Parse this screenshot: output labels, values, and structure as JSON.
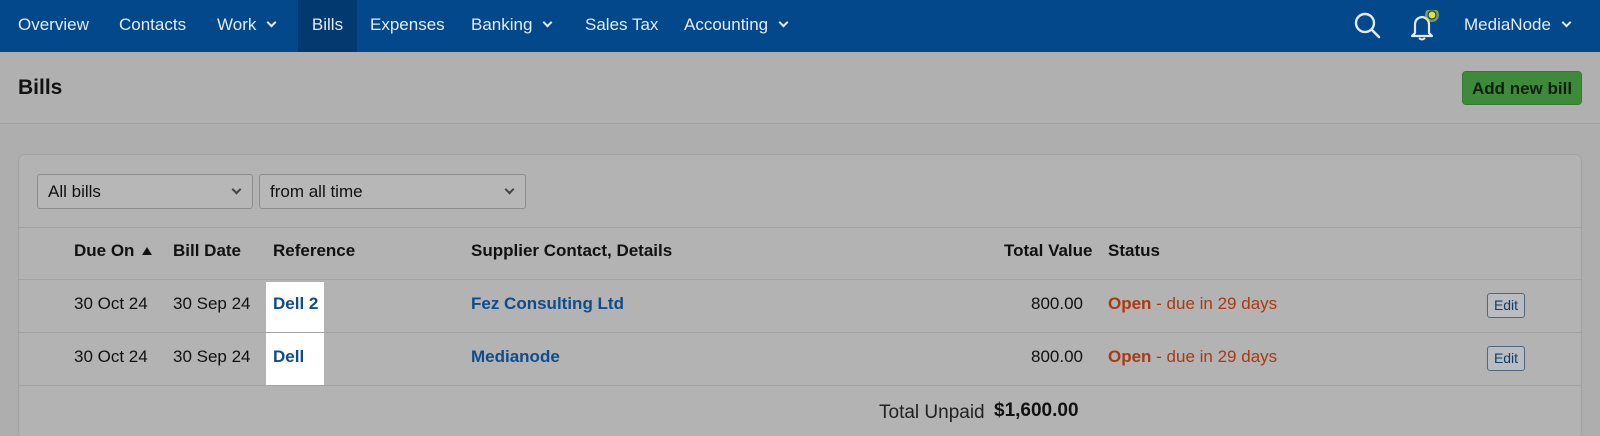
{
  "nav": {
    "items": [
      {
        "label": "Overview"
      },
      {
        "label": "Contacts"
      },
      {
        "label": "Work"
      },
      {
        "label": "Bills"
      },
      {
        "label": "Expenses"
      },
      {
        "label": "Banking"
      },
      {
        "label": "Sales Tax"
      },
      {
        "label": "Accounting"
      }
    ],
    "account_label": "MediaNode",
    "icons": [
      "search-icon",
      "bell-icon",
      "chevron-down-icon"
    ],
    "colors": {
      "bar": "#03488b",
      "active": "#023a70",
      "notification": "#e8e02a"
    }
  },
  "page": {
    "title": "Bills",
    "add_button_label": "Add new bill",
    "add_button_color": "#3d8a3a"
  },
  "filters": {
    "type_value": "All bills",
    "period_value": "from all time"
  },
  "table": {
    "columns": {
      "due_on": "Due On",
      "bill_date": "Bill Date",
      "reference": "Reference",
      "supplier": "Supplier Contact, Details",
      "total_value": "Total Value",
      "status": "Status"
    },
    "sorted_by": "Due On",
    "rows": [
      {
        "due_on": "30 Oct 24",
        "bill_date": "30 Sep 24",
        "reference": "Dell 2",
        "supplier": "Fez Consulting Ltd",
        "total_value": "800.00",
        "status_main": "Open",
        "status_detail": " - due in 29 days",
        "edit_label": "Edit"
      },
      {
        "due_on": "30 Oct 24",
        "bill_date": "30 Sep 24",
        "reference": "Dell",
        "supplier": "Medianode",
        "total_value": "800.00",
        "status_main": "Open",
        "status_detail": " - due in 29 days",
        "edit_label": "Edit"
      }
    ],
    "total_label": "Total Unpaid",
    "total_value": "$1,600.00",
    "status_color": "#a83a12",
    "link_color": "#0f4b8f"
  }
}
